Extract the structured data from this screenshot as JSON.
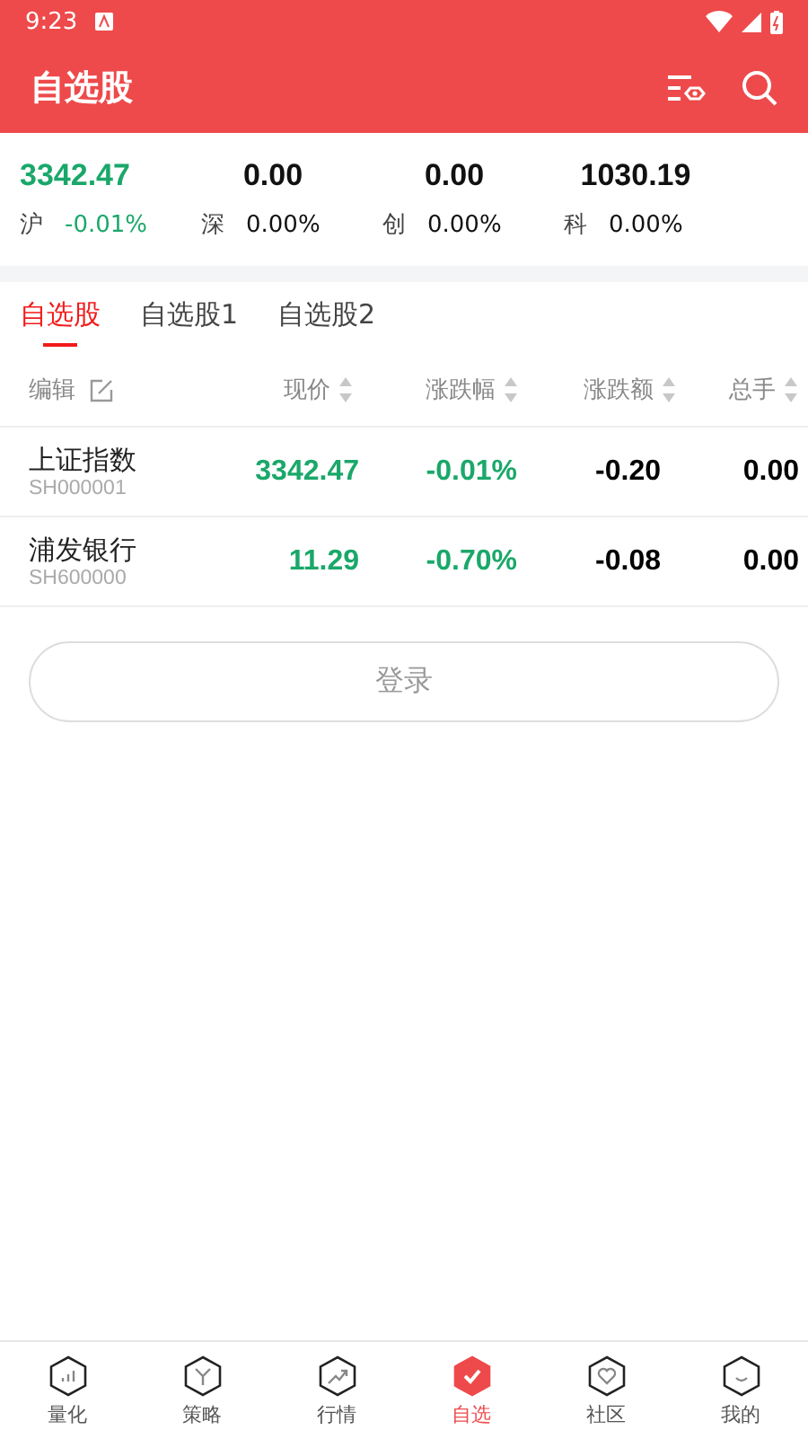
{
  "status_bar": {
    "time": "9:23"
  },
  "app_bar": {
    "title": "自选股"
  },
  "indices": [
    {
      "value": "3342.47",
      "market": "沪",
      "change": "-0.01%",
      "color": "#1aa86a"
    },
    {
      "value": "0.00",
      "market": "深",
      "change": "0.00%",
      "color": "#111111"
    },
    {
      "value": "0.00",
      "market": "创",
      "change": "0.00%",
      "color": "#111111"
    },
    {
      "value": "1030.19",
      "market": "科",
      "change": "0.00%",
      "color": "#111111"
    }
  ],
  "tabs": [
    {
      "label": "自选股",
      "selected": true
    },
    {
      "label": "自选股1",
      "selected": false
    },
    {
      "label": "自选股2",
      "selected": false
    }
  ],
  "table": {
    "edit_label": "编辑",
    "columns": [
      "现价",
      "涨跌幅",
      "涨跌额",
      "总手"
    ],
    "rows": [
      {
        "name": "上证指数",
        "code": "SH000001",
        "price": "3342.47",
        "pct": "-0.01%",
        "change": "-0.20",
        "volume": "0.00",
        "color": "#1aa86a"
      },
      {
        "name": "浦发银行",
        "code": "SH600000",
        "price": "11.29",
        "pct": "-0.70%",
        "change": "-0.08",
        "volume": "0.00",
        "color": "#1aa86a"
      }
    ]
  },
  "login_button": "登录",
  "nav": [
    {
      "label": "量化",
      "selected": false
    },
    {
      "label": "策略",
      "selected": false
    },
    {
      "label": "行情",
      "selected": false
    },
    {
      "label": "自选",
      "selected": true
    },
    {
      "label": "社区",
      "selected": false
    },
    {
      "label": "我的",
      "selected": false
    }
  ]
}
